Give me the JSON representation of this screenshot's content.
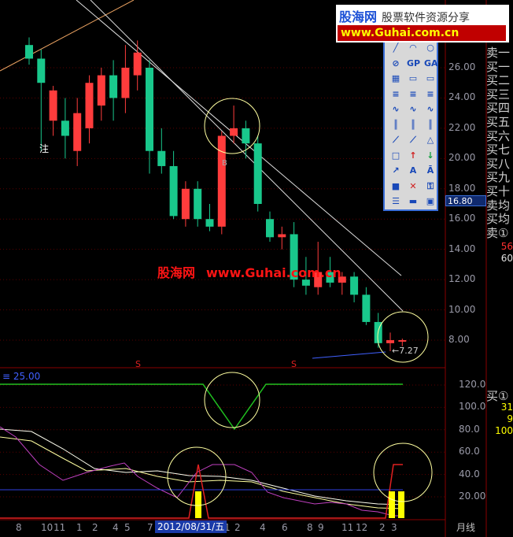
{
  "logo": {
    "brand": "股海网",
    "subtitle": "股票软件资源分享",
    "domain": "www.Guhai.com.cn"
  },
  "watermark": {
    "brand": "股海网",
    "domain": "www.Guhai.com.cn"
  },
  "price_axis": [
    "26.00",
    "24.00",
    "22.00",
    "20.00",
    "18.00",
    "16.00",
    "14.00",
    "12.00",
    "10.00",
    "8.00"
  ],
  "current_price_label": "16.80",
  "last_price_label": "←7.27",
  "indicator": {
    "label": "25.00",
    "ticks": [
      "120.0",
      "100.0",
      "80.0",
      "60.0",
      "40.0",
      "20.00"
    ]
  },
  "side_labels": [
    "卖一",
    "买一",
    "买二",
    "买三",
    "买四",
    "买五",
    "买六",
    "买七",
    "买八",
    "买九",
    "买十",
    "卖均",
    "买均",
    "卖①"
  ],
  "side_numbers_top": [
    {
      "text": "56",
      "color": "#ff3030"
    },
    {
      "text": "60",
      "color": "#e0e0e0"
    }
  ],
  "side_label_bottom": "买①",
  "side_numbers_bottom": [
    {
      "text": "31",
      "color": "#ffff00"
    },
    {
      "text": "9",
      "color": "#ffff00"
    },
    {
      "text": "100",
      "color": "#ffff00"
    }
  ],
  "date_axis": [
    "8",
    "10",
    "11",
    "1",
    "2",
    "4",
    "5",
    "7",
    "1",
    "2",
    "4",
    "6",
    "8",
    "9",
    "11",
    "12",
    "2",
    "3"
  ],
  "selected_date": "2012/08/31/五",
  "period": "月线",
  "note": "注",
  "b_mark": "B",
  "s_mark": "S",
  "colors": {
    "up": "#ff3c3c",
    "down": "#19c88c",
    "bg": "#000000",
    "accent": "#3a6ed8"
  },
  "toolbox_icons": [
    "line",
    "arc",
    "circle",
    "no",
    "GP",
    "GA",
    "grid",
    "rect",
    "rect",
    "fib",
    "fib",
    "fib",
    "wave",
    "wave",
    "wave",
    "bars",
    "bars",
    "bars",
    "fan",
    "fan",
    "triangle",
    "square",
    "arrow-up",
    "arrow-down",
    "arrow-diag",
    "A",
    "A-box",
    "stop",
    "close",
    "lock",
    "list",
    "ruler",
    "screen"
  ],
  "chart_data": {
    "type": "candlestick",
    "ylim": [
      7,
      28
    ],
    "candles": [
      {
        "o": 27.5,
        "h": 28.0,
        "l": 26.2,
        "c": 26.6
      },
      {
        "o": 26.6,
        "h": 27.2,
        "l": 20.5,
        "c": 25.0
      },
      {
        "o": 22.5,
        "h": 24.8,
        "l": 21.5,
        "c": 24.5
      },
      {
        "o": 22.5,
        "h": 24.0,
        "l": 20.0,
        "c": 21.5
      },
      {
        "o": 20.5,
        "h": 24.0,
        "l": 19.5,
        "c": 23.0
      },
      {
        "o": 22.0,
        "h": 25.5,
        "l": 21.0,
        "c": 25.0
      },
      {
        "o": 23.5,
        "h": 26.0,
        "l": 22.5,
        "c": 25.5
      },
      {
        "o": 25.5,
        "h": 26.5,
        "l": 22.5,
        "c": 24.0
      },
      {
        "o": 24.0,
        "h": 27.5,
        "l": 23.0,
        "c": 26.0
      },
      {
        "o": 25.5,
        "h": 27.8,
        "l": 24.5,
        "c": 27.0
      },
      {
        "o": 26.0,
        "h": 26.5,
        "l": 19.0,
        "c": 20.5
      },
      {
        "o": 20.5,
        "h": 22.0,
        "l": 19.0,
        "c": 19.5
      },
      {
        "o": 19.5,
        "h": 20.5,
        "l": 16.0,
        "c": 16.2
      },
      {
        "o": 16.0,
        "h": 18.5,
        "l": 15.5,
        "c": 18.0
      },
      {
        "o": 18.0,
        "h": 18.5,
        "l": 15.5,
        "c": 16.0
      },
      {
        "o": 16.0,
        "h": 17.0,
        "l": 15.2,
        "c": 15.5
      },
      {
        "o": 15.5,
        "h": 21.8,
        "l": 15.0,
        "c": 21.5
      },
      {
        "o": 21.5,
        "h": 23.5,
        "l": 21.0,
        "c": 22.0
      },
      {
        "o": 22.0,
        "h": 22.5,
        "l": 20.0,
        "c": 21.0
      },
      {
        "o": 21.0,
        "h": 21.5,
        "l": 16.5,
        "c": 17.0
      },
      {
        "o": 16.0,
        "h": 16.5,
        "l": 14.5,
        "c": 14.8
      },
      {
        "o": 14.8,
        "h": 15.5,
        "l": 14.0,
        "c": 15.0
      },
      {
        "o": 15.0,
        "h": 15.8,
        "l": 11.5,
        "c": 12.0
      },
      {
        "o": 12.0,
        "h": 13.5,
        "l": 11.0,
        "c": 11.6
      },
      {
        "o": 11.5,
        "h": 14.5,
        "l": 11.0,
        "c": 12.5
      },
      {
        "o": 12.5,
        "h": 13.5,
        "l": 11.5,
        "c": 11.8
      },
      {
        "o": 11.8,
        "h": 12.5,
        "l": 11.0,
        "c": 12.2
      },
      {
        "o": 12.2,
        "h": 12.5,
        "l": 10.5,
        "c": 11.0
      },
      {
        "o": 11.0,
        "h": 11.5,
        "l": 9.0,
        "c": 9.2
      },
      {
        "o": 9.2,
        "h": 9.8,
        "l": 7.5,
        "c": 7.8
      },
      {
        "o": 7.8,
        "h": 8.5,
        "l": 7.27,
        "c": 8.0
      },
      {
        "o": 7.9,
        "h": 8.1,
        "l": 7.6,
        "c": 8.0
      }
    ]
  }
}
